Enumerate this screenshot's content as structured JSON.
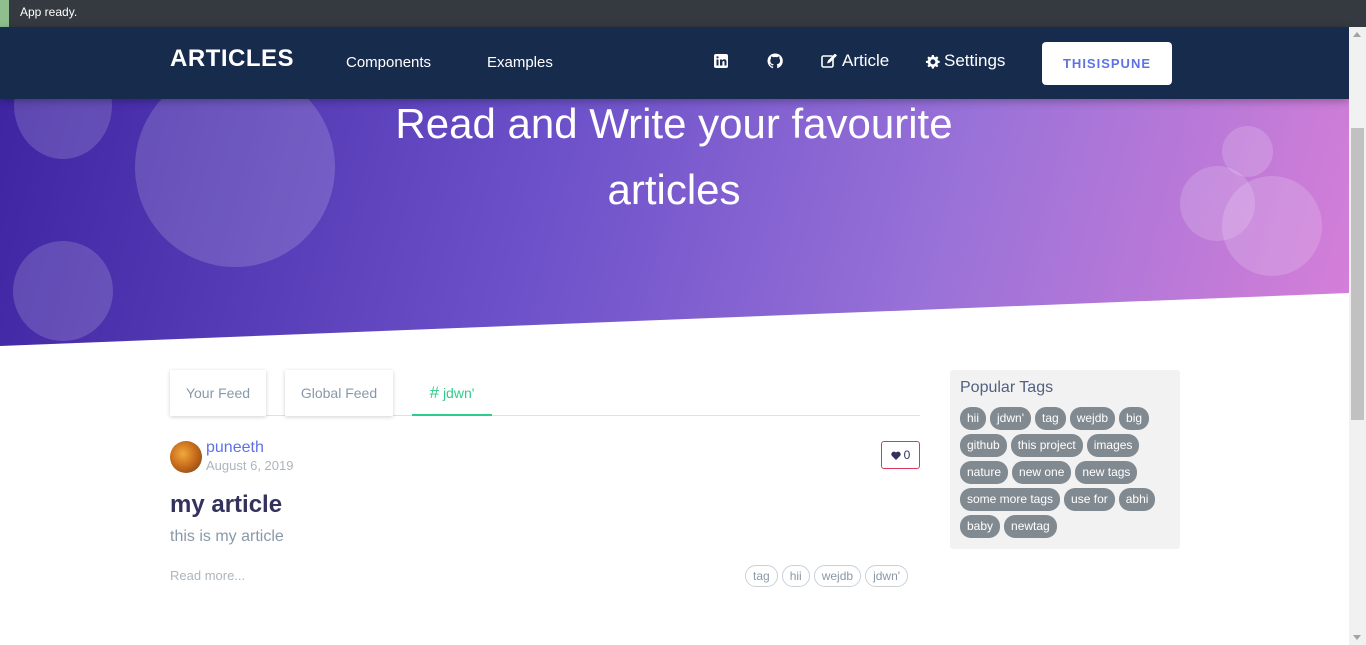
{
  "status_bar": {
    "text": "App ready."
  },
  "navbar": {
    "brand": "ARTICLES",
    "links": [
      "Components",
      "Examples"
    ],
    "icons": [
      "linkedin-icon",
      "github-icon"
    ],
    "article_label": "Article",
    "settings_label": "Settings",
    "user_button": "THISISPUNE"
  },
  "hero": {
    "title_line1": "Read and Write your favourite",
    "title_line2": "articles"
  },
  "tabs": {
    "your_feed": "Your Feed",
    "global_feed": "Global Feed",
    "tag_feed": "jdwn'",
    "tag_prefix": "#"
  },
  "article": {
    "author": "puneeth",
    "date": "August 6, 2019",
    "likes": "0",
    "title": "my article",
    "description": "this is my article",
    "read_more": "Read more...",
    "tags": [
      "tag",
      "hii",
      "wejdb",
      "jdwn'"
    ]
  },
  "sidebar": {
    "title": "Popular Tags",
    "tags": [
      "hii",
      "jdwn'",
      "tag",
      "wejdb",
      "big",
      "github",
      "this project",
      "images",
      "nature",
      "new one",
      "new tags",
      "some more tags",
      "use for",
      "abhi",
      "baby",
      "newtag"
    ]
  },
  "colors": {
    "navbar": "#172b4d",
    "accent_blue": "#5e72e4",
    "accent_green": "#2dce89",
    "like_red": "#d9395f"
  }
}
